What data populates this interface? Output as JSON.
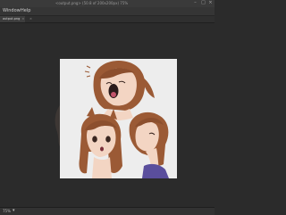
{
  "window": {
    "title": "<output.png> (50.8 of 200x200px) 75%",
    "minimize_glyph": "–",
    "maximize_glyph": "□",
    "close_glyph": "×"
  },
  "menubar": {
    "items": [
      "Window",
      "Help"
    ]
  },
  "tabs": [
    {
      "label": "output.png",
      "close": "×"
    },
    {
      "label": "",
      "close": "×"
    }
  ],
  "status": {
    "zoom": "75%",
    "chevron": "▾"
  },
  "colors": {
    "hair": "#9b5a35",
    "hair_light": "#c9885f",
    "skin": "#f3d5c3",
    "shirt": "#5a4e9c",
    "canvas": "#ededed",
    "workspace": "#2b2b2b"
  }
}
